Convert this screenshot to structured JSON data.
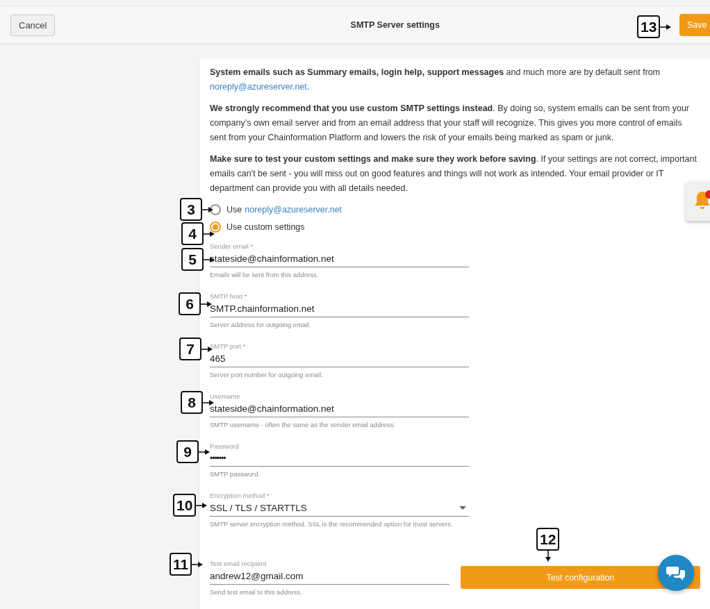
{
  "header": {
    "cancel": "Cancel",
    "title": "SMTP Server settings",
    "save": "Save"
  },
  "intro": [
    {
      "text": "**System emails such as Summary emails, login help, support messages** and much more are by default sent from",
      "link": "noreply@azureserver.net",
      "after": "."
    },
    {
      "text": "**We strongly recommend that you use custom SMTP settings instead**. By doing so, system emails can be sent from your company’s own email server and from an email address that your staff will recognize. This gives you more control of emails sent from your Chainformation Platform and lowers the risk of your emails being marked as spam or junk."
    },
    {
      "text": "**Make sure to test your custom settings and make sure they work before saving**. If your settings are not correct, important emails can't be sent - you will miss out on good features and things will not work as intended. Your email provider or IT department can provide you with all details needed."
    }
  ],
  "options": [
    {
      "label": "Use",
      "link": "noreply@azureserver.net",
      "selected": false
    },
    {
      "label": "Use custom settings",
      "selected": true
    }
  ],
  "fields": [
    {
      "kind": "text",
      "label": "Sender email *",
      "value": "stateside@chainformation.net",
      "helper": "Emails will be sent from this address."
    },
    {
      "kind": "text",
      "label": "SMTP host *",
      "value": "SMTP.chainformation.net",
      "helper": "Server address for outgoing email."
    },
    {
      "kind": "text",
      "label": "SMTP port *",
      "value": "465",
      "helper": "Server port number for outgoing email."
    },
    {
      "kind": "text",
      "label": "Username",
      "value": "stateside@chainformation.net",
      "helper": "SMTP username - often the same as the sender email address."
    },
    {
      "kind": "password",
      "label": "Password",
      "value": "•••••••",
      "helper": "SMTP password."
    },
    {
      "kind": "select",
      "label": "Encryption method *",
      "value": "SSL / TLS / STARTTLS",
      "helper": "SMTP server encryption method. SSL is the recommended option for most servers."
    }
  ],
  "test": {
    "label": "Test email recipient",
    "value": "andrew12@gmail.com",
    "helper": "Send test email to this address.",
    "button": "Test configuration"
  },
  "notifications": {
    "unread": true
  },
  "callouts": [
    {
      "label": "3",
      "kind": "right"
    },
    {
      "label": "4",
      "kind": "right"
    },
    {
      "label": "5",
      "kind": "right"
    },
    {
      "label": "6",
      "kind": "right"
    },
    {
      "label": "7",
      "kind": "right"
    },
    {
      "label": "8",
      "kind": "right"
    },
    {
      "label": "9",
      "kind": "right"
    },
    {
      "label": "10",
      "kind": "right"
    },
    {
      "label": "11",
      "kind": "right"
    },
    {
      "label": "12",
      "kind": "down"
    },
    {
      "label": "13",
      "kind": "right"
    }
  ]
}
